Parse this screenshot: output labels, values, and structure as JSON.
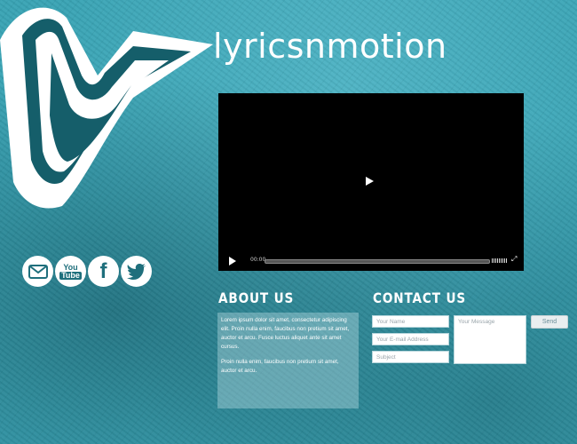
{
  "brand": {
    "name": "lyricsnmotion"
  },
  "video": {
    "time": "00:00"
  },
  "social": {
    "items": [
      {
        "icon": "email-icon",
        "label": ""
      },
      {
        "icon": "youtube-icon",
        "label": "You Tube"
      },
      {
        "icon": "facebook-icon",
        "label": "f"
      },
      {
        "icon": "twitter-icon",
        "label": ""
      }
    ]
  },
  "about": {
    "title": "ABOUT US",
    "paragraphs": [
      "Lorem ipsum dolor sit amet, consectetur adipiscing elit. Proin nulla enim, faucibus non pretium sit amet, auctor et arcu. Fusce luctus aliquet ante sit amet cursus.",
      "Proin nulla enim, faucibus non pretium sit amet, auctor et arcu."
    ]
  },
  "contact": {
    "title": "CONTACT US",
    "name_placeholder": "Your Name",
    "email_placeholder": "Your E-mail Address",
    "subject_placeholder": "Subject",
    "message_placeholder": "Your Message",
    "send_label": "Send"
  },
  "colors": {
    "background": "#3aa4b5",
    "logo": "#ffffff",
    "logo_dark": "#155e6a"
  }
}
